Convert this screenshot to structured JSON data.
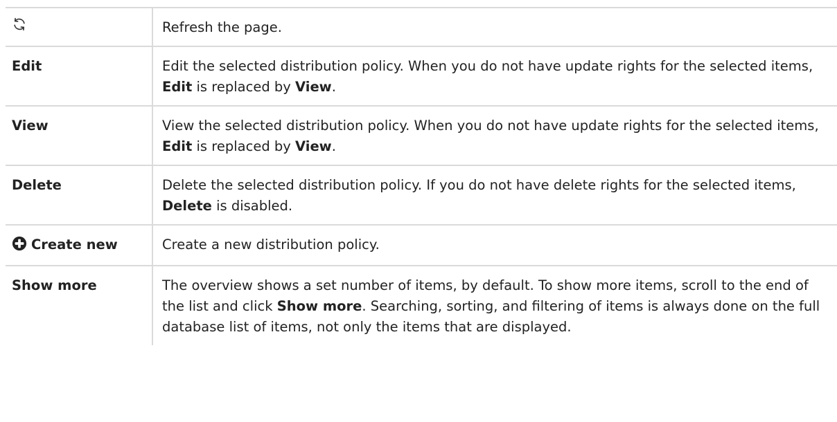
{
  "rows": [
    {
      "icon": "refresh-icon",
      "description": [
        {
          "text": "Refresh the page."
        }
      ]
    },
    {
      "label": "Edit",
      "description": [
        {
          "text": "Edit the selected distribution policy. When you do not have update rights for the selected items, "
        },
        {
          "text": "Edit",
          "bold": true
        },
        {
          "text": " is replaced by "
        },
        {
          "text": "View",
          "bold": true
        },
        {
          "text": "."
        }
      ]
    },
    {
      "label": "View",
      "description": [
        {
          "text": "View the selected distribution policy. When you do not have update rights for the selected items, "
        },
        {
          "text": "Edit",
          "bold": true
        },
        {
          "text": " is replaced by "
        },
        {
          "text": "View",
          "bold": true
        },
        {
          "text": "."
        }
      ]
    },
    {
      "label": "Delete",
      "description": [
        {
          "text": "Delete the selected distribution policy. If you do not have delete rights for the selected items, "
        },
        {
          "text": "Delete",
          "bold": true
        },
        {
          "text": " is disabled."
        }
      ]
    },
    {
      "icon": "plus-circle-icon",
      "label": "Create new",
      "description": [
        {
          "text": "Create a new distribution policy."
        }
      ]
    },
    {
      "label": "Show more",
      "description": [
        {
          "text": "The overview shows a set number of items, by default. To show more items, scroll to the end of the list and click "
        },
        {
          "text": "Show more",
          "bold": true
        },
        {
          "text": ". Searching, sorting, and filtering of items is always done on the full database list of items, not only the items that are displayed."
        }
      ]
    }
  ]
}
